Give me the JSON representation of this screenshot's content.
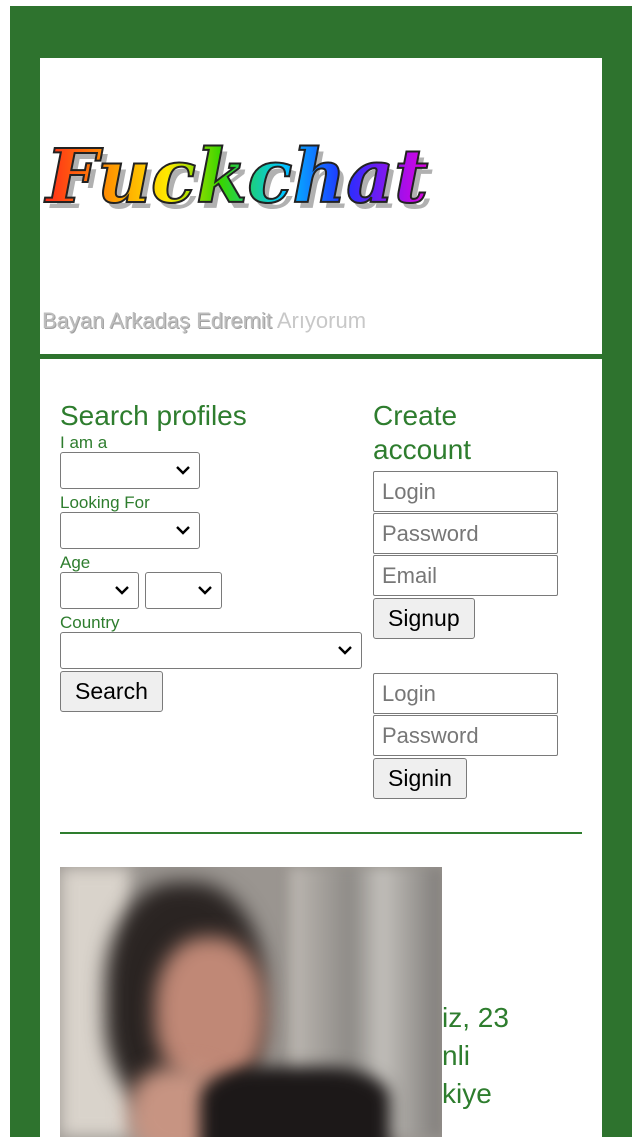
{
  "header": {
    "logo_text": "Fuckchat",
    "tagline_lead": "Bayan Arkadaş Edremit",
    "tagline_tail": "Arıyorum"
  },
  "search": {
    "title": "Search profiles",
    "iam_label": "I am a",
    "looking_label": "Looking For",
    "age_label": "Age",
    "country_label": "Country",
    "search_button": "Search"
  },
  "create": {
    "title": "Create account",
    "login_placeholder": "Login",
    "password_placeholder": "Password",
    "email_placeholder": "Email",
    "signup_button": "Signup"
  },
  "signin": {
    "login_placeholder": "Login",
    "password_placeholder": "Password",
    "signin_button": "Signin"
  },
  "profile": {
    "line1": "iz, 23",
    "line2": "nli",
    "line3": "kiye"
  },
  "colors": {
    "frame": "#2e732e",
    "accent": "#2e7d2e"
  }
}
